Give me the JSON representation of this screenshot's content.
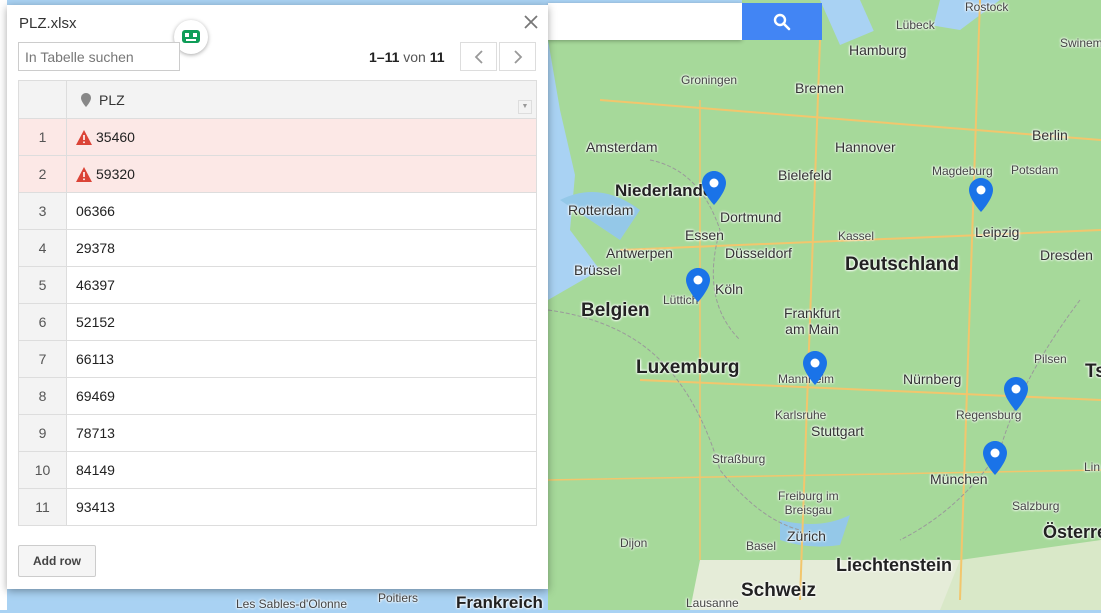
{
  "panel": {
    "title": "PLZ.xlsx",
    "search_placeholder": "In Tabelle suchen",
    "pager": {
      "range": "1–11",
      "of": "von",
      "total": "11"
    },
    "column_header": "PLZ",
    "rows": [
      {
        "num": "1",
        "plz": "35460",
        "error": true
      },
      {
        "num": "2",
        "plz": "59320",
        "error": true
      },
      {
        "num": "3",
        "plz": "06366",
        "error": false
      },
      {
        "num": "4",
        "plz": "29378",
        "error": false
      },
      {
        "num": "5",
        "plz": "46397",
        "error": false
      },
      {
        "num": "6",
        "plz": "52152",
        "error": false
      },
      {
        "num": "7",
        "plz": "66113",
        "error": false
      },
      {
        "num": "8",
        "plz": "69469",
        "error": false
      },
      {
        "num": "9",
        "plz": "78713",
        "error": false
      },
      {
        "num": "10",
        "plz": "84149",
        "error": false
      },
      {
        "num": "11",
        "plz": "93413",
        "error": false
      }
    ],
    "add_row_label": "Add row"
  },
  "map": {
    "labels": {
      "hamburg": "Hamburg",
      "bremen": "Bremen",
      "luebeck": "Lübeck",
      "rostock": "Rostock",
      "swinemuende": "Swinem",
      "groningen": "Groningen",
      "amsterdam": "Amsterdam",
      "niederlande": "Niederlande",
      "rotterdam": "Rotterdam",
      "bielefeld": "Bielefeld",
      "hannover": "Hannover",
      "berlin": "Berlin",
      "potsdam": "Potsdam",
      "magdeburg": "Magdeburg",
      "dortmund": "Dortmund",
      "essen": "Essen",
      "duesseldorf": "Düsseldorf",
      "antwerpen": "Antwerpen",
      "kassel": "Kassel",
      "leipzig": "Leipzig",
      "dresden": "Dresden",
      "bruessel": "Brüssel",
      "deutschland": "Deutschland",
      "koeln": "Köln",
      "luettich": "Lüttich",
      "belgien": "Belgien",
      "frankfurt": "Frankfurt\nam Main",
      "luxemburg": "Luxemburg",
      "mannheim": "Mannheim",
      "nuernberg": "Nürnberg",
      "pilsen": "Pilsen",
      "regensburg": "Regensburg",
      "karlsruhe": "Karlsruhe",
      "stuttgart": "Stuttgart",
      "strassburg": "Straßburg",
      "muenchen": "München",
      "freiburg": "Freiburg im\nBreisgau",
      "salzburg": "Salzburg",
      "dijon": "Dijon",
      "basel": "Basel",
      "zuerich": "Zürich",
      "liechtenstein": "Liechtenstein",
      "oesterreich": "Österre",
      "schweiz": "Schweiz",
      "frankreich": "Frankreich",
      "poitiers": "Poitiers",
      "les_sables": "Les Sables-d'Olonne",
      "lausanne": "Lausanne",
      "ts": "Ts",
      "lin": "Lin"
    },
    "colors": {
      "pin": "#1a73e8",
      "land": "#a6d99a",
      "water": "#a9d2f3",
      "search": "#4285f4",
      "error": "#fce8e6",
      "warning": "#db4437"
    }
  }
}
